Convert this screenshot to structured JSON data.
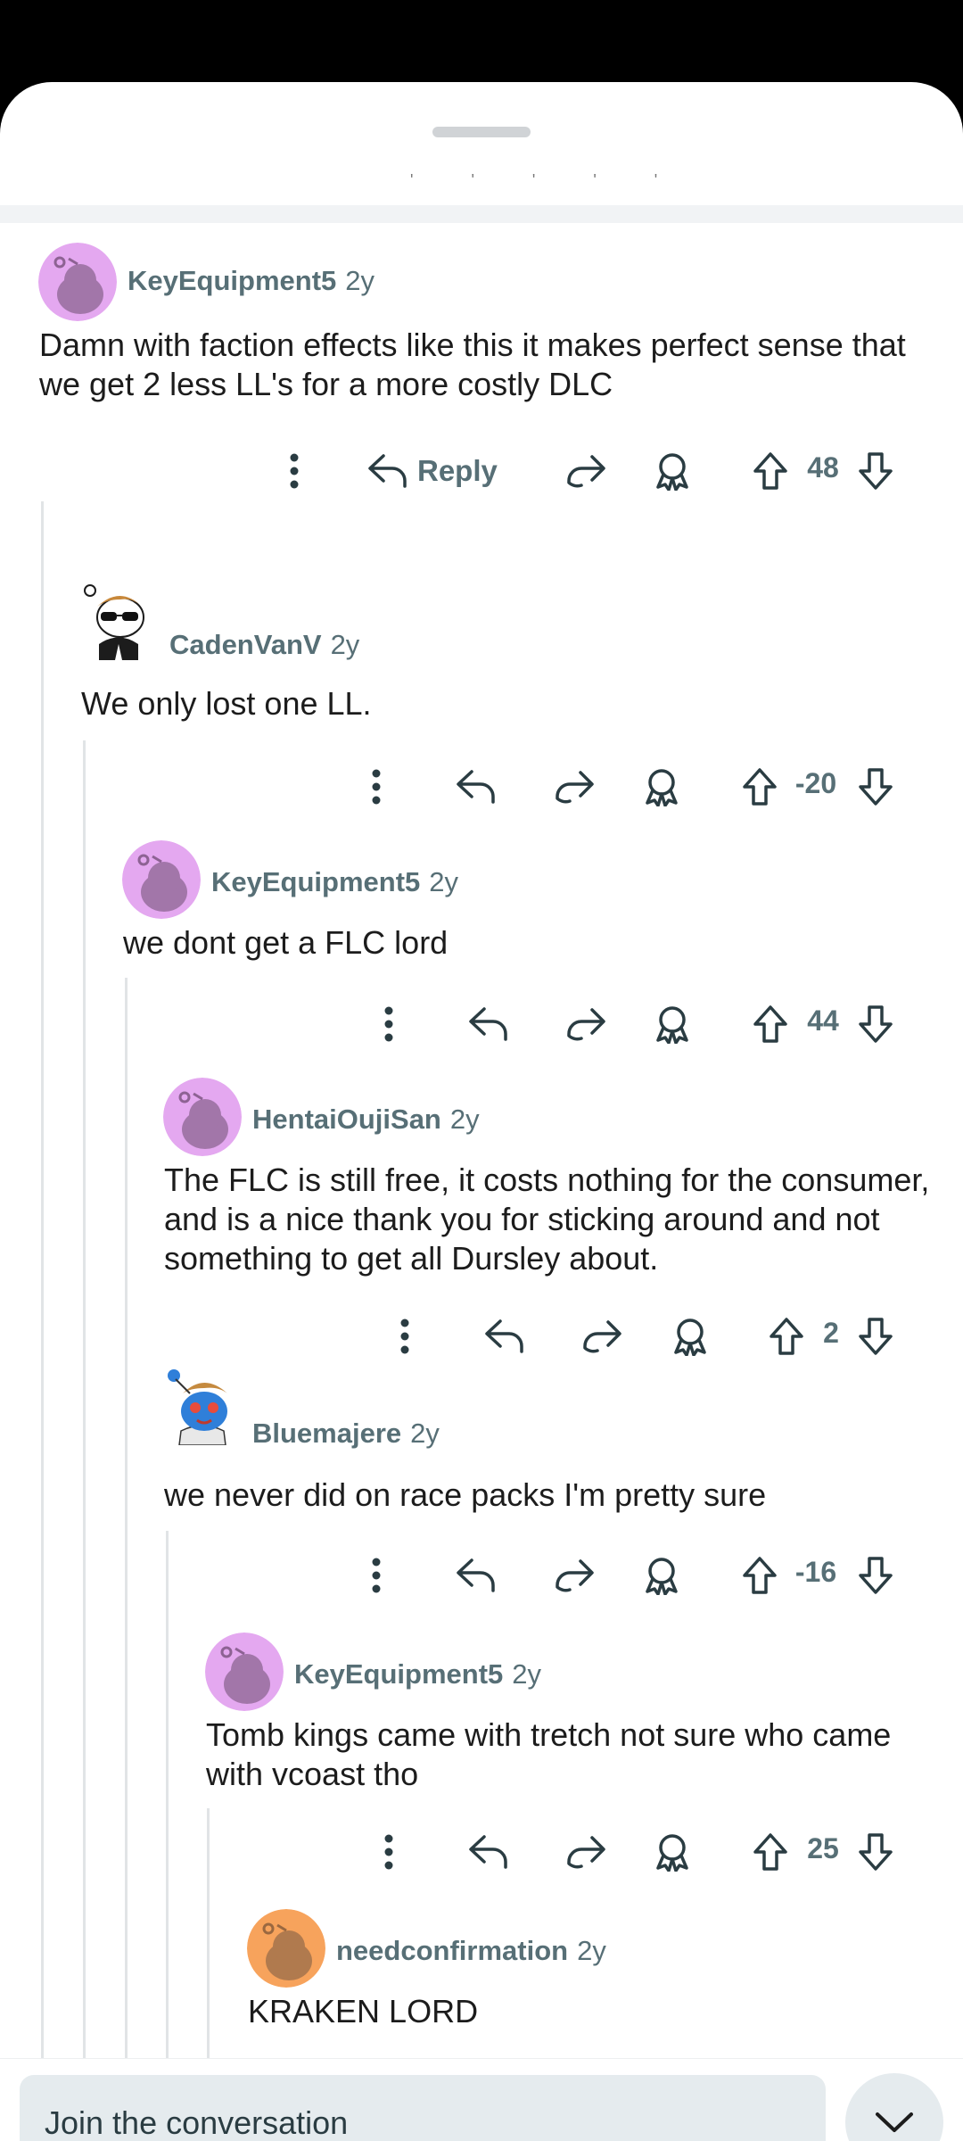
{
  "comments": [
    {
      "author": "KeyEquipment5",
      "age": "2y",
      "body": "Damn with faction effects like this it makes perfect sense that we get 2 less LL's for a more costly DLC",
      "score": "48",
      "reply_label": "Reply"
    },
    {
      "author": "CadenVanV",
      "age": "2y",
      "body": "We only lost one LL.",
      "score": "-20"
    },
    {
      "author": "KeyEquipment5",
      "age": "2y",
      "body": "we dont get a FLC lord",
      "score": "44"
    },
    {
      "author": "HentaiOujiSan",
      "age": "2y",
      "body": "The FLC is still free, it costs nothing for the consumer, and is a nice thank you for sticking around and not something to get all Dursley about.",
      "score": "2"
    },
    {
      "author": "Bluemajere",
      "age": "2y",
      "body": "we never did on race packs I'm pretty sure",
      "score": "-16"
    },
    {
      "author": "KeyEquipment5",
      "age": "2y",
      "body": "Tomb kings came with tretch not sure who came with vcoast tho",
      "score": "25"
    },
    {
      "author": "needconfirmation",
      "age": "2y",
      "body": "KRAKEN LORD"
    }
  ],
  "composer": {
    "placeholder": "Join the conversation"
  },
  "colors": {
    "meta_text": "#576f76",
    "avatar_purple": "#e4a8f0",
    "avatar_orange": "#f7a35c",
    "input_bg": "#e5ebee"
  },
  "icons": [
    "more-vertical-icon",
    "reply-icon",
    "share-icon",
    "award-icon",
    "upvote-icon",
    "downvote-icon",
    "chevron-down-icon"
  ]
}
